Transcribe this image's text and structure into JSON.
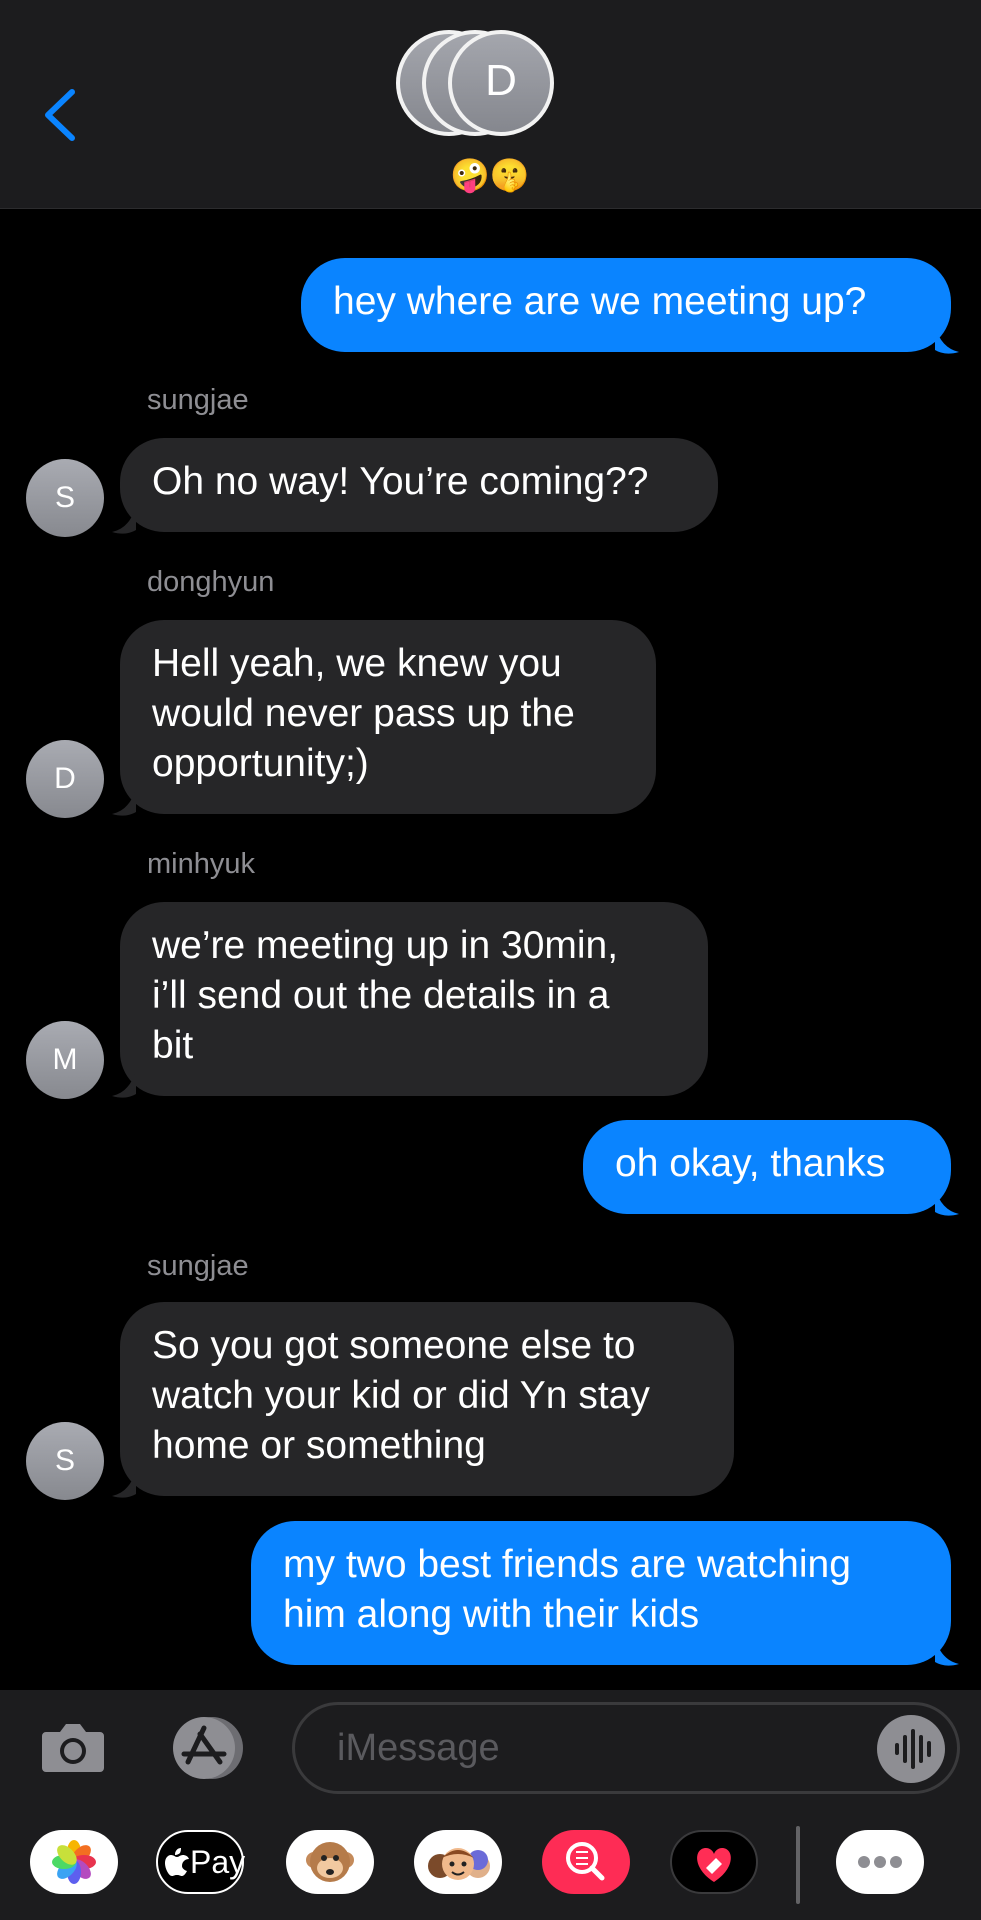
{
  "header": {
    "group_avatar_letter": "D",
    "emojis": [
      "🤪",
      "🤫"
    ]
  },
  "messages": [
    {
      "direction": "out",
      "text": "hey where are we meeting up?"
    },
    {
      "direction": "in",
      "sender": "sungjae",
      "avatar": "S",
      "text": "Oh no way! You’re coming??"
    },
    {
      "direction": "in",
      "sender": "donghyun",
      "avatar": "D",
      "text": "Hell yeah, we knew you\nwould never pass up the\nopportunity;)"
    },
    {
      "direction": "in",
      "sender": "minhyuk",
      "avatar": "M",
      "text": "we’re meeting up in 30min,\ni’ll send out the details in a\nbit"
    },
    {
      "direction": "out",
      "text": "oh okay, thanks"
    },
    {
      "direction": "in",
      "sender": "sungjae",
      "avatar": "S",
      "text": "So you got someone else to\nwatch your kid or did Yn stay\nhome or something"
    },
    {
      "direction": "out",
      "text": "my two best friends are watching\nhim along with their kids"
    }
  ],
  "compose": {
    "placeholder": "iMessage"
  },
  "drawer": {
    "apps": [
      {
        "name": "photos-icon"
      },
      {
        "name": "apple-pay-icon",
        "label": "Pay"
      },
      {
        "name": "animoji-icon"
      },
      {
        "name": "memoji-icon"
      },
      {
        "name": "images-search-icon"
      },
      {
        "name": "digital-touch-icon"
      },
      {
        "name": "more-apps-icon"
      }
    ]
  },
  "colors": {
    "outgoing_bubble": "#0a84ff",
    "incoming_bubble": "#262628",
    "background": "#000000",
    "bars": "#1c1c1e",
    "accent": "#0a84ff"
  }
}
